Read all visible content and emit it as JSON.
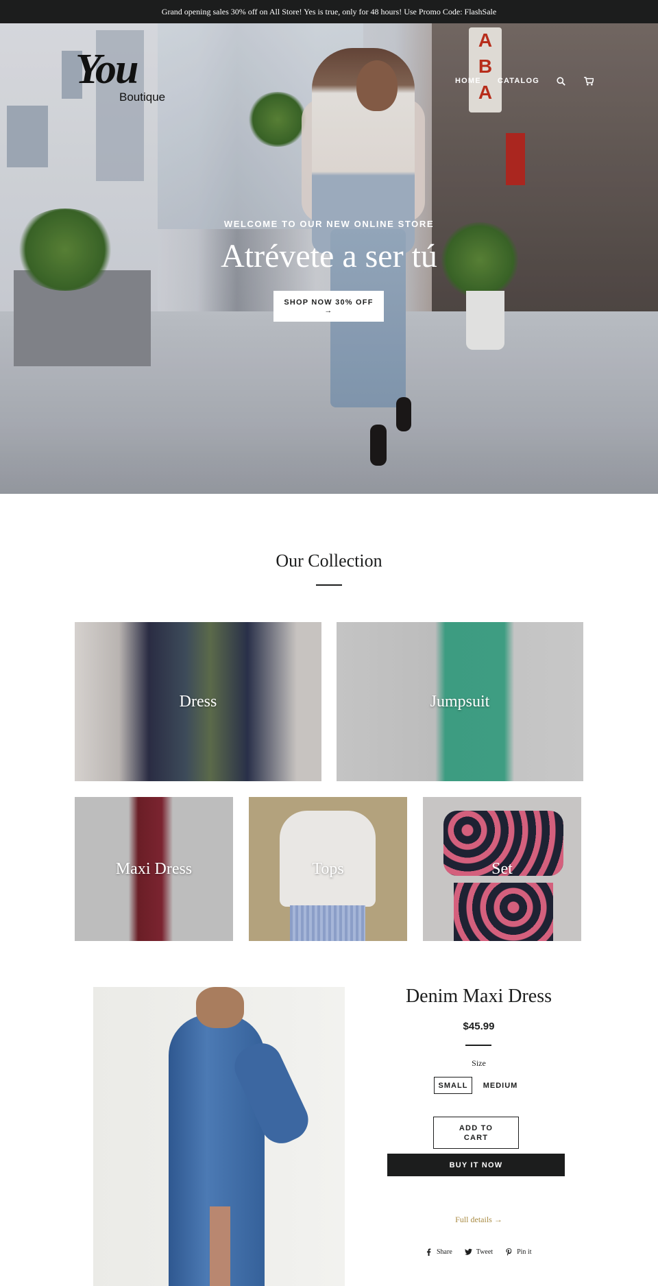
{
  "announcement": {
    "text": "Grand opening sales 30% off on All Store! Yes is true, only for 48 hours! Use Promo Code: FlashSale"
  },
  "brand": {
    "script_text": "You",
    "sub_text": "Boutique"
  },
  "nav": {
    "home": "HOME",
    "catalog": "CATALOG",
    "icons": [
      "search-icon",
      "cart-icon"
    ]
  },
  "hero": {
    "subtitle": "WELCOME TO OUR NEW ONLINE STORE",
    "title": "Atrévete a ser tú",
    "button_label": "SHOP NOW 30% OFF",
    "button_arrow": "→"
  },
  "collection": {
    "title": "Our Collection",
    "tiles": [
      {
        "label": "Dress"
      },
      {
        "label": "Jumpsuit"
      },
      {
        "label": "Maxi Dress"
      },
      {
        "label": "Tops"
      },
      {
        "label": "Set"
      }
    ]
  },
  "product": {
    "title": "Denim Maxi Dress",
    "price": "$45.99",
    "size_label": "Size",
    "sizes": [
      "SMALL",
      "MEDIUM"
    ],
    "selected_size": "SMALL",
    "add_to_cart": "ADD TO CART",
    "buy_now": "BUY IT NOW",
    "full_details": "Full details",
    "full_details_arrow": "→",
    "share": {
      "facebook": "Share",
      "twitter": "Tweet",
      "pinterest": "Pin it"
    }
  },
  "colors": {
    "dark": "#1c1d1d",
    "accent": "#a88a42",
    "white": "#ffffff"
  }
}
